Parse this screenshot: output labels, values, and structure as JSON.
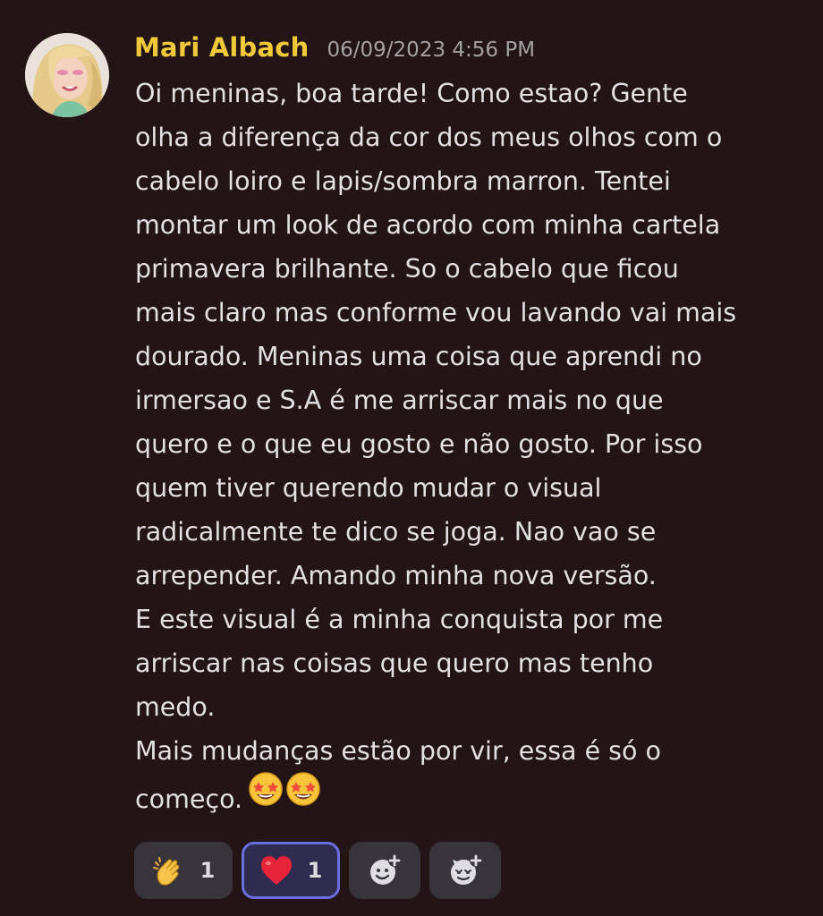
{
  "message": {
    "author": "Mari Albach",
    "timestamp": "06/09/2023 4:56 PM",
    "lines": [
      "Oi meninas, boa tarde! Como estao?  Gente",
      "olha a diferença da cor dos meus olhos com o",
      "cabelo loiro e lapis/sombra marron. Tentei",
      "montar um look de acordo com minha cartela",
      "primavera brilhante.  So o cabelo que ficou",
      "mais claro mas conforme vou lavando vai mais",
      "dourado. Meninas uma coisa que aprendi no",
      "irmersao e S.A é me arriscar mais no que",
      "quero e o que eu gosto e não gosto.  Por isso",
      "quem tiver querendo mudar o visual",
      "radicalmente te dico se joga. Nao vao se",
      "arrepender. Amando minha nova versão.",
      "E este visual é a minha conquista por me",
      "arriscar nas coisas que quero mas tenho",
      "medo.",
      "Mais mudanças estão por vir,  essa é só o",
      "começo."
    ],
    "trailing_emoji": "star-struck-face-icon"
  },
  "reactions": [
    {
      "icon": "clapping-hands-icon",
      "count": "1",
      "active": false
    },
    {
      "icon": "red-heart-icon",
      "count": "1",
      "active": true
    }
  ],
  "reaction_actions": [
    {
      "icon": "add-reaction-icon"
    },
    {
      "icon": "add-super-reaction-icon"
    }
  ],
  "colors": {
    "background": "#231416",
    "username": "#f0c93a",
    "timestamp": "#a4a1a5",
    "text": "#e2e0e3",
    "reaction_bg": "#38343b",
    "reaction_active_bg": "#2f2c4f",
    "reaction_active_border": "#6a6ee0"
  }
}
